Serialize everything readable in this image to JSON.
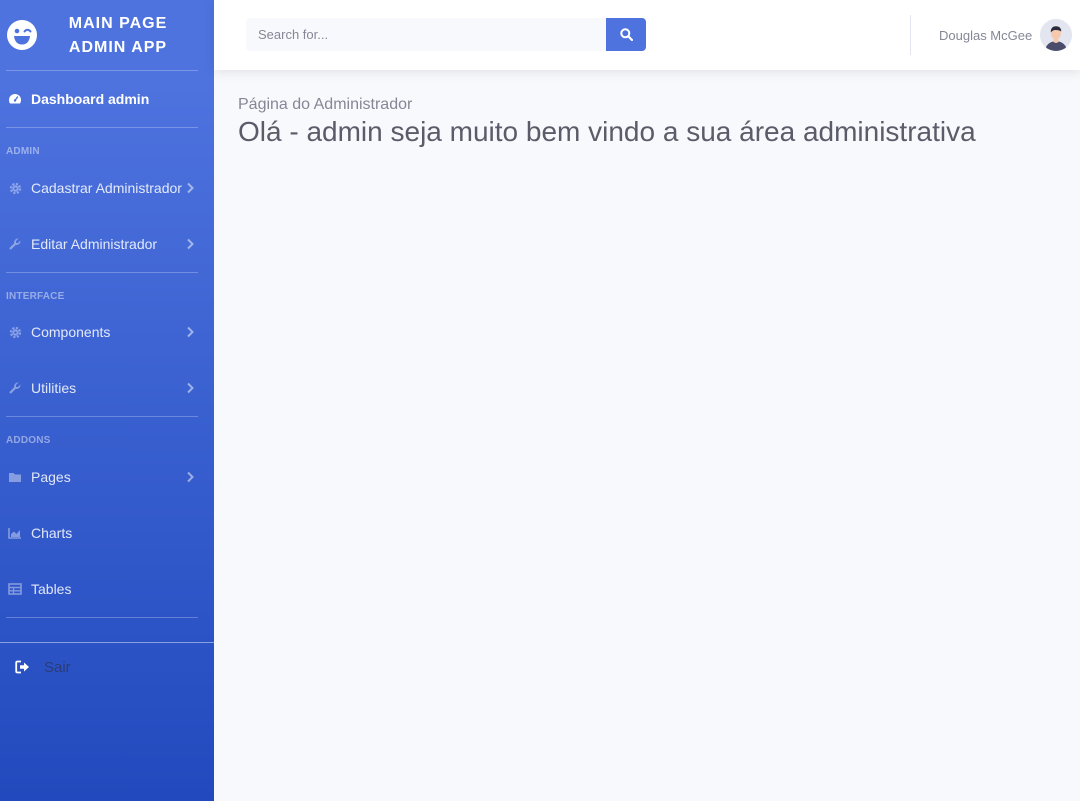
{
  "brand": {
    "line1": "MAIN PAGE",
    "line2": "ADMIN APP",
    "icon": "laugh-wink-icon"
  },
  "sidebar": {
    "dashboard": {
      "label": "Dashboard admin",
      "icon": "tachometer-icon"
    },
    "sections": [
      {
        "heading": "ADMIN",
        "items": [
          {
            "label": "Cadastrar Administrador",
            "icon": "cog-icon"
          },
          {
            "label": "Editar Administrador",
            "icon": "wrench-icon"
          }
        ]
      },
      {
        "heading": "INTERFACE",
        "items": [
          {
            "label": "Components",
            "icon": "cog-icon"
          },
          {
            "label": "Utilities",
            "icon": "wrench-icon"
          }
        ]
      },
      {
        "heading": "ADDONS",
        "items": [
          {
            "label": "Pages",
            "icon": "folder-icon"
          },
          {
            "label": "Charts",
            "icon": "chart-area-icon"
          },
          {
            "label": "Tables",
            "icon": "table-icon"
          }
        ]
      }
    ],
    "logout": {
      "label": "Sair",
      "icon": "sign-out-icon"
    }
  },
  "topbar": {
    "search": {
      "placeholder": "Search for...",
      "value": "",
      "icon": "search-icon"
    },
    "user": {
      "name": "Douglas McGee",
      "avatar": "user-avatar"
    }
  },
  "main": {
    "subtitle": "Página do Administrador",
    "title": "Olá - admin seja muito bem vindo a sua área administrativa"
  },
  "colors": {
    "primary": "#4e73df",
    "primary_dark": "#224abe",
    "background": "#f8f9fc",
    "text": "#5a5c69",
    "muted": "#858796"
  }
}
